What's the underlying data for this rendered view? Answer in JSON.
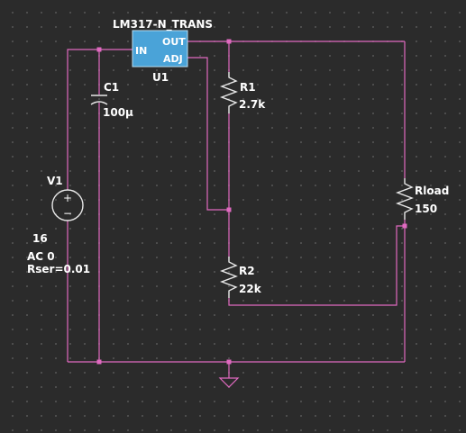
{
  "regulator": {
    "model": "LM317-N_TRANS",
    "ref": "U1",
    "pin_in": "IN",
    "pin_out": "OUT",
    "pin_adj": "ADJ"
  },
  "capacitor": {
    "ref": "C1",
    "value": "100µ"
  },
  "source": {
    "ref": "V1",
    "value": "16",
    "ac": "AC 0",
    "rser": "Rser=0.01",
    "plus_symbol": "+",
    "minus_symbol": "−"
  },
  "r1": {
    "ref": "R1",
    "value": "2.7k"
  },
  "r2": {
    "ref": "R2",
    "value": "22k"
  },
  "rload": {
    "ref": "Rload",
    "value": "150"
  },
  "colors": {
    "wire": "#e06ac0",
    "component": "#e8e8e8",
    "regulator_fill": "#4aa3d8",
    "background": "#2b2b2b"
  }
}
